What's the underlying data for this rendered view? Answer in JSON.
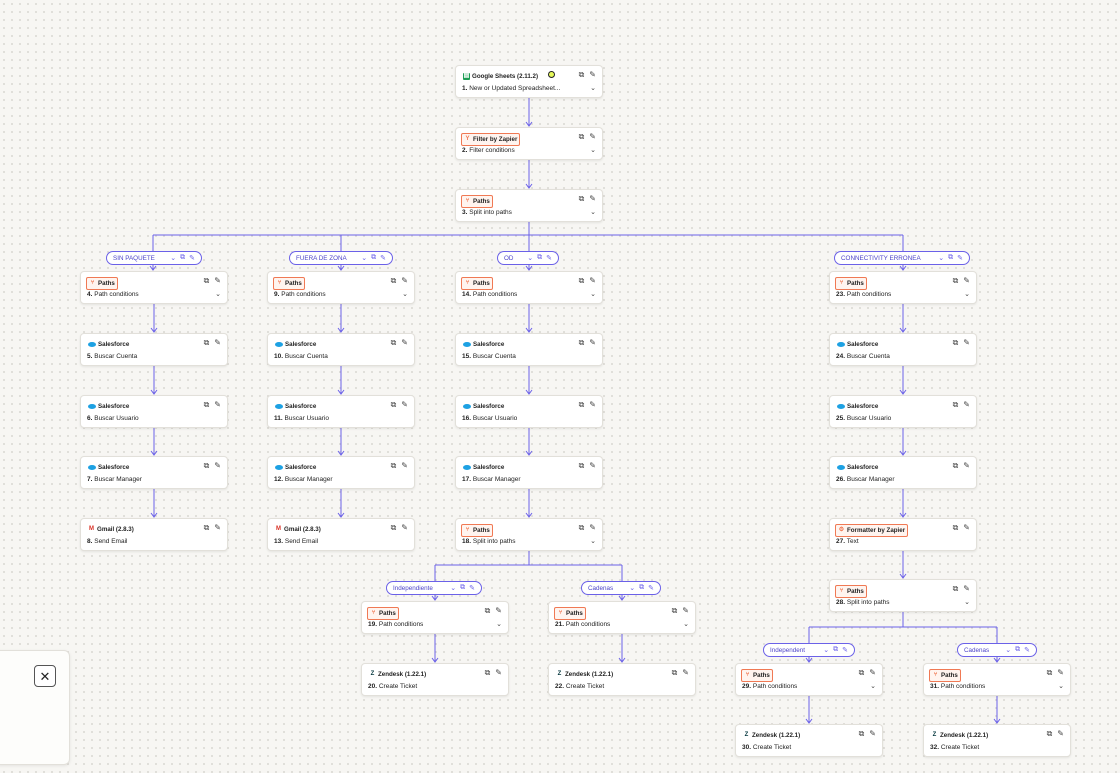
{
  "colors": {
    "accent": "#6b61e8",
    "paths": "#f07954",
    "wire": "#6b61e8"
  },
  "steps": [
    {
      "id": "s1",
      "app": "Google Sheets (2.11.2)",
      "icon": "google-sheets-icon",
      "badge": "plain",
      "num": "1.",
      "label": "New or Updated Spreadsheet...",
      "chevron": true,
      "live": true
    },
    {
      "id": "s2",
      "app": "Filter by Zapier",
      "icon": "filter-icon",
      "badge": "filter",
      "num": "2.",
      "label": "Filter conditions",
      "chevron": true
    },
    {
      "id": "s3",
      "app": "Paths",
      "icon": "paths-icon",
      "badge": "paths",
      "num": "3.",
      "label": "Split into paths",
      "chevron": true
    },
    {
      "id": "s4",
      "app": "Paths",
      "icon": "paths-icon",
      "badge": "paths",
      "num": "4.",
      "label": "Path conditions",
      "chevron": true
    },
    {
      "id": "s5",
      "app": "Salesforce",
      "icon": "salesforce-icon",
      "badge": "plain",
      "num": "5.",
      "label": "Buscar Cuenta"
    },
    {
      "id": "s6",
      "app": "Salesforce",
      "icon": "salesforce-icon",
      "badge": "plain",
      "num": "6.",
      "label": "Buscar Usuario"
    },
    {
      "id": "s7",
      "app": "Salesforce",
      "icon": "salesforce-icon",
      "badge": "plain",
      "num": "7.",
      "label": "Buscar Manager"
    },
    {
      "id": "s8",
      "app": "Gmail (2.8.3)",
      "icon": "gmail-icon",
      "badge": "plain",
      "num": "8.",
      "label": "Send Email"
    },
    {
      "id": "s9",
      "app": "Paths",
      "icon": "paths-icon",
      "badge": "paths",
      "num": "9.",
      "label": "Path conditions",
      "chevron": true
    },
    {
      "id": "s10",
      "app": "Salesforce",
      "icon": "salesforce-icon",
      "badge": "plain",
      "num": "10.",
      "label": "Buscar Cuenta"
    },
    {
      "id": "s11",
      "app": "Salesforce",
      "icon": "salesforce-icon",
      "badge": "plain",
      "num": "11.",
      "label": "Buscar Usuario"
    },
    {
      "id": "s12",
      "app": "Salesforce",
      "icon": "salesforce-icon",
      "badge": "plain",
      "num": "12.",
      "label": "Buscar Manager"
    },
    {
      "id": "s13",
      "app": "Gmail (2.8.3)",
      "icon": "gmail-icon",
      "badge": "plain",
      "num": "13.",
      "label": "Send Email"
    },
    {
      "id": "s14",
      "app": "Paths",
      "icon": "paths-icon",
      "badge": "paths",
      "num": "14.",
      "label": "Path conditions",
      "chevron": true
    },
    {
      "id": "s15",
      "app": "Salesforce",
      "icon": "salesforce-icon",
      "badge": "plain",
      "num": "15.",
      "label": "Buscar Cuenta"
    },
    {
      "id": "s16",
      "app": "Salesforce",
      "icon": "salesforce-icon",
      "badge": "plain",
      "num": "16.",
      "label": "Buscar Usuario"
    },
    {
      "id": "s17",
      "app": "Salesforce",
      "icon": "salesforce-icon",
      "badge": "plain",
      "num": "17.",
      "label": "Buscar Manager"
    },
    {
      "id": "s18",
      "app": "Paths",
      "icon": "paths-icon",
      "badge": "paths",
      "num": "18.",
      "label": "Split into paths",
      "chevron": true
    },
    {
      "id": "s19",
      "app": "Paths",
      "icon": "paths-icon",
      "badge": "paths",
      "num": "19.",
      "label": "Path conditions",
      "chevron": true
    },
    {
      "id": "s20",
      "app": "Zendesk (1.22.1)",
      "icon": "zendesk-icon",
      "badge": "plain",
      "num": "20.",
      "label": "Create Ticket"
    },
    {
      "id": "s21",
      "app": "Paths",
      "icon": "paths-icon",
      "badge": "paths",
      "num": "21.",
      "label": "Path conditions",
      "chevron": true
    },
    {
      "id": "s22",
      "app": "Zendesk (1.22.1)",
      "icon": "zendesk-icon",
      "badge": "plain",
      "num": "22.",
      "label": "Create Ticket"
    },
    {
      "id": "s23",
      "app": "Paths",
      "icon": "paths-icon",
      "badge": "paths",
      "num": "23.",
      "label": "Path conditions",
      "chevron": true
    },
    {
      "id": "s24",
      "app": "Salesforce",
      "icon": "salesforce-icon",
      "badge": "plain",
      "num": "24.",
      "label": "Buscar Cuenta"
    },
    {
      "id": "s25",
      "app": "Salesforce",
      "icon": "salesforce-icon",
      "badge": "plain",
      "num": "25.",
      "label": "Buscar Usuario"
    },
    {
      "id": "s26",
      "app": "Salesforce",
      "icon": "salesforce-icon",
      "badge": "plain",
      "num": "26.",
      "label": "Buscar Manager"
    },
    {
      "id": "s27",
      "app": "Formatter by Zapier",
      "icon": "formatter-icon",
      "badge": "formatter",
      "num": "27.",
      "label": "Text"
    },
    {
      "id": "s28",
      "app": "Paths",
      "icon": "paths-icon",
      "badge": "paths",
      "num": "28.",
      "label": "Split into paths",
      "chevron": true
    },
    {
      "id": "s29",
      "app": "Paths",
      "icon": "paths-icon",
      "badge": "paths",
      "num": "29.",
      "label": "Path conditions",
      "chevron": true
    },
    {
      "id": "s30",
      "app": "Zendesk (1.22.1)",
      "icon": "zendesk-icon",
      "badge": "plain",
      "num": "30.",
      "label": "Create Ticket"
    },
    {
      "id": "s31",
      "app": "Paths",
      "icon": "paths-icon",
      "badge": "paths",
      "num": "31.",
      "label": "Path conditions",
      "chevron": true
    },
    {
      "id": "s32",
      "app": "Zendesk (1.22.1)",
      "icon": "zendesk-icon",
      "badge": "plain",
      "num": "32.",
      "label": "Create Ticket"
    }
  ],
  "paths": [
    {
      "id": "p1",
      "name": "SIN PAQUETE"
    },
    {
      "id": "p2",
      "name": "FUERA DE ZONA"
    },
    {
      "id": "p3",
      "name": "OD"
    },
    {
      "id": "p4",
      "name": "CONNECTIVITY ERRONEA"
    },
    {
      "id": "p5",
      "name": "Independiente"
    },
    {
      "id": "p6",
      "name": "Cadenas"
    },
    {
      "id": "p7",
      "name": "Independent"
    },
    {
      "id": "p8",
      "name": "Cadenas"
    }
  ],
  "side_panel": {
    "close_icon": "close-icon"
  }
}
